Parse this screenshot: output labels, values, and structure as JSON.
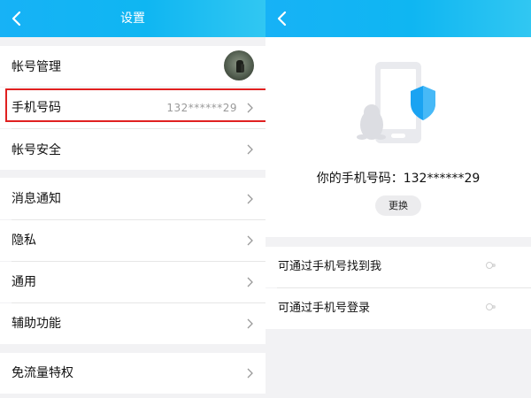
{
  "settings": {
    "title": "设置",
    "items": {
      "account_management": "帐号管理",
      "phone_number": {
        "label": "手机号码",
        "value": "132******29"
      },
      "account_security": "帐号安全",
      "notifications": "消息通知",
      "privacy": "隐私",
      "general": "通用",
      "accessibility": "辅助功能",
      "data_free_privilege": "免流量特权"
    },
    "highlighted_item": "手机号码"
  },
  "phone_detail": {
    "number_text": "你的手机号码：132******29",
    "change_button": "更换",
    "options": [
      {
        "label": "可通过手机号找到我",
        "enabled": false
      },
      {
        "label": "可通过手机号登录",
        "enabled": false
      }
    ]
  },
  "colors": {
    "header_blue": "#17b2f6",
    "highlight_red": "#e02020",
    "shield_blue": "#1aa3f2",
    "background_gray": "#f2f2f4"
  },
  "icons": [
    "back-arrow-icon",
    "chevron-right-icon",
    "shield-icon",
    "phone-icon",
    "penguin-icon",
    "toggle-switch"
  ]
}
